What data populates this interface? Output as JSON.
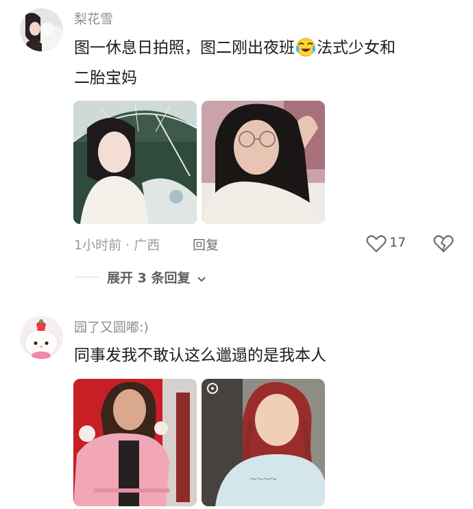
{
  "comments": [
    {
      "username": "梨花雪",
      "text_line1_a": "图一休息日拍照，图二刚出夜班",
      "text_line1_b": "法式少女和",
      "text_line2": "二胎宝妈",
      "emoji": "crying-laughing-emoji",
      "time_location": "1小时前 · 广西",
      "reply_label": "回复",
      "likes": "17",
      "expand_label": "展开 3 条回复"
    },
    {
      "username": "园了又圆嘟:)",
      "text": "同事发我不敢认这么邋遢的是我本人"
    }
  ],
  "colors": {
    "username": "#8e8e8e",
    "text": "#1c1c1c",
    "meta": "#9a9a9a"
  }
}
